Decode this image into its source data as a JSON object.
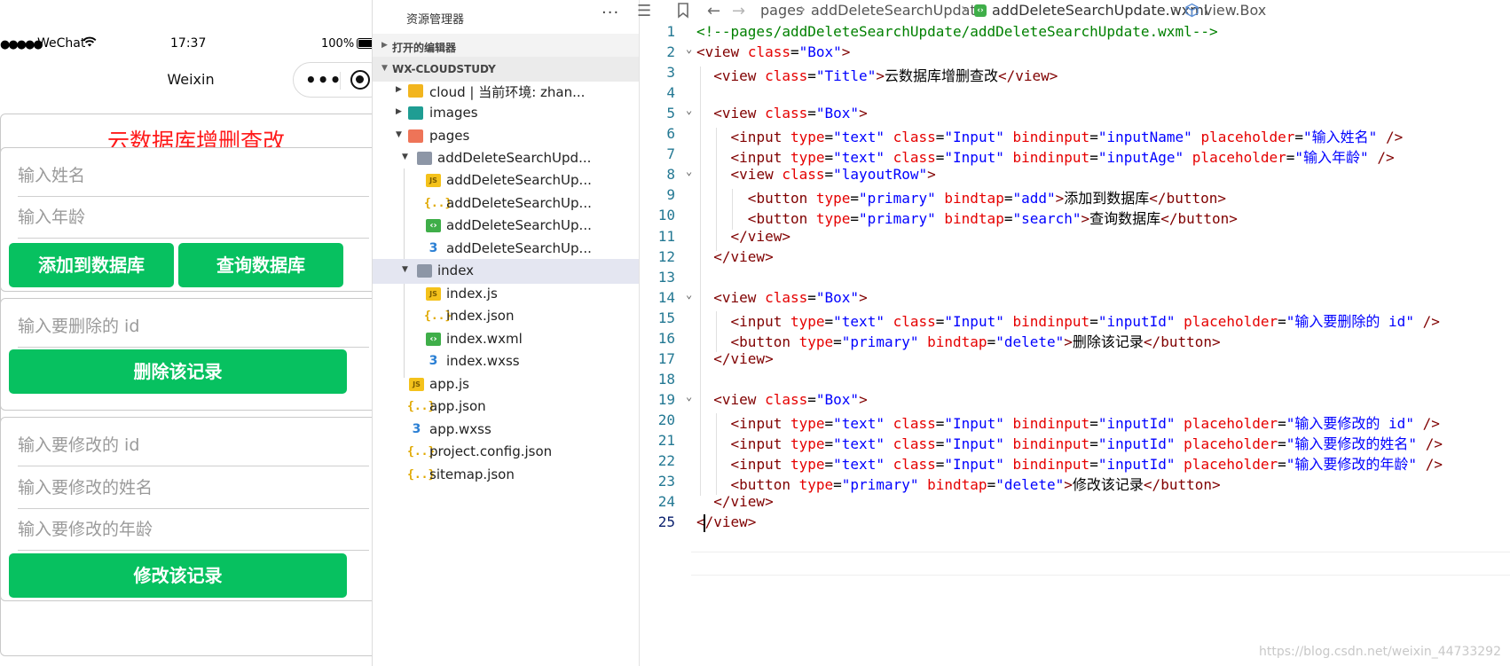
{
  "simulator": {
    "status": {
      "carrier": "WeChat",
      "time": "17:37",
      "battery": "100%"
    },
    "nav_title": "Weixin",
    "page_title": "云数据库增删查改",
    "box1": {
      "name_placeholder": "输入姓名",
      "age_placeholder": "输入年龄",
      "add_button": "添加到数据库",
      "search_button": "查询数据库"
    },
    "box2": {
      "id_placeholder": "输入要删除的 id",
      "delete_button": "删除该记录"
    },
    "box3": {
      "id_placeholder": "输入要修改的 id",
      "name_placeholder": "输入要修改的姓名",
      "age_placeholder": "输入要修改的年龄",
      "update_button": "修改该记录"
    }
  },
  "explorer": {
    "title": "资源管理器",
    "more": "···",
    "sections": {
      "open_editors": "打开的编辑器",
      "project": "WX-CLOUDSTUDY"
    },
    "tree": [
      {
        "label": "cloud | 当前环境: zhan...",
        "icon": "folder-cloud-icon"
      },
      {
        "label": "images",
        "icon": "folder-images-icon"
      },
      {
        "label": "pages",
        "icon": "folder-pages-icon"
      },
      {
        "label": "addDeleteSearchUpd...",
        "icon": "folder-open-icon"
      },
      {
        "label": "addDeleteSearchUp...",
        "icon": "js-file-icon"
      },
      {
        "label": "addDeleteSearchUp...",
        "icon": "json-file-icon"
      },
      {
        "label": "addDeleteSearchUp...",
        "icon": "wxml-file-icon"
      },
      {
        "label": "addDeleteSearchUp...",
        "icon": "wxss-file-icon"
      },
      {
        "label": "index",
        "icon": "folder-open-icon"
      },
      {
        "label": "index.js",
        "icon": "js-file-icon"
      },
      {
        "label": "index.json",
        "icon": "json-file-icon"
      },
      {
        "label": "index.wxml",
        "icon": "wxml-file-icon"
      },
      {
        "label": "index.wxss",
        "icon": "wxss-file-icon"
      },
      {
        "label": "app.js",
        "icon": "js-file-icon"
      },
      {
        "label": "app.json",
        "icon": "json-file-icon"
      },
      {
        "label": "app.wxss",
        "icon": "wxss-file-icon"
      },
      {
        "label": "project.config.json",
        "icon": "json-file-icon"
      },
      {
        "label": "sitemap.json",
        "icon": "json-file-icon"
      }
    ]
  },
  "editor": {
    "breadcrumb": {
      "part1": "pages",
      "part2": "addDeleteSearchUpdate",
      "part3": "addDeleteSearchUpdate.wxml",
      "part4": "view.Box"
    },
    "lines": [
      [
        [
          "cmt",
          "<!--pages/addDeleteSearchUpdate/addDeleteSearchUpdate.wxml-->"
        ]
      ],
      [
        [
          "punct",
          "<"
        ],
        [
          "tag",
          "view"
        ],
        [
          "txt-c",
          " "
        ],
        [
          "attr",
          "class"
        ],
        [
          "txt-c",
          "="
        ],
        [
          "str",
          "\"Box\""
        ],
        [
          "punct",
          ">"
        ]
      ],
      [
        [
          "txt-c",
          "  "
        ],
        [
          "punct",
          "<"
        ],
        [
          "tag",
          "view"
        ],
        [
          "txt-c",
          " "
        ],
        [
          "attr",
          "class"
        ],
        [
          "txt-c",
          "="
        ],
        [
          "str",
          "\"Title\""
        ],
        [
          "punct",
          ">"
        ],
        [
          "txt-c",
          "云数据库增删查改"
        ],
        [
          "punct",
          "</"
        ],
        [
          "tag",
          "view"
        ],
        [
          "punct",
          ">"
        ]
      ],
      [],
      [
        [
          "txt-c",
          "  "
        ],
        [
          "punct",
          "<"
        ],
        [
          "tag",
          "view"
        ],
        [
          "txt-c",
          " "
        ],
        [
          "attr",
          "class"
        ],
        [
          "txt-c",
          "="
        ],
        [
          "str",
          "\"Box\""
        ],
        [
          "punct",
          ">"
        ]
      ],
      [
        [
          "txt-c",
          "    "
        ],
        [
          "punct",
          "<"
        ],
        [
          "tag",
          "input"
        ],
        [
          "txt-c",
          " "
        ],
        [
          "attr",
          "type"
        ],
        [
          "txt-c",
          "="
        ],
        [
          "str",
          "\"text\""
        ],
        [
          "txt-c",
          " "
        ],
        [
          "attr",
          "class"
        ],
        [
          "txt-c",
          "="
        ],
        [
          "str",
          "\"Input\""
        ],
        [
          "txt-c",
          " "
        ],
        [
          "attr",
          "bindinput"
        ],
        [
          "txt-c",
          "="
        ],
        [
          "str",
          "\"inputName\""
        ],
        [
          "txt-c",
          " "
        ],
        [
          "attr",
          "placeholder"
        ],
        [
          "txt-c",
          "="
        ],
        [
          "str",
          "\"输入姓名\""
        ],
        [
          "txt-c",
          " "
        ],
        [
          "punct",
          "/>"
        ]
      ],
      [
        [
          "txt-c",
          "    "
        ],
        [
          "punct",
          "<"
        ],
        [
          "tag",
          "input"
        ],
        [
          "txt-c",
          " "
        ],
        [
          "attr",
          "type"
        ],
        [
          "txt-c",
          "="
        ],
        [
          "str",
          "\"text\""
        ],
        [
          "txt-c",
          " "
        ],
        [
          "attr",
          "class"
        ],
        [
          "txt-c",
          "="
        ],
        [
          "str",
          "\"Input\""
        ],
        [
          "txt-c",
          " "
        ],
        [
          "attr",
          "bindinput"
        ],
        [
          "txt-c",
          "="
        ],
        [
          "str",
          "\"inputAge\""
        ],
        [
          "txt-c",
          " "
        ],
        [
          "attr",
          "placeholder"
        ],
        [
          "txt-c",
          "="
        ],
        [
          "str",
          "\"输入年龄\""
        ],
        [
          "txt-c",
          " "
        ],
        [
          "punct",
          "/>"
        ]
      ],
      [
        [
          "txt-c",
          "    "
        ],
        [
          "punct",
          "<"
        ],
        [
          "tag",
          "view"
        ],
        [
          "txt-c",
          " "
        ],
        [
          "attr",
          "class"
        ],
        [
          "txt-c",
          "="
        ],
        [
          "str",
          "\"layoutRow\""
        ],
        [
          "punct",
          ">"
        ]
      ],
      [
        [
          "txt-c",
          "      "
        ],
        [
          "punct",
          "<"
        ],
        [
          "tag",
          "button"
        ],
        [
          "txt-c",
          " "
        ],
        [
          "attr",
          "type"
        ],
        [
          "txt-c",
          "="
        ],
        [
          "str",
          "\"primary\""
        ],
        [
          "txt-c",
          " "
        ],
        [
          "attr",
          "bindtap"
        ],
        [
          "txt-c",
          "="
        ],
        [
          "str",
          "\"add\""
        ],
        [
          "punct",
          ">"
        ],
        [
          "txt-c",
          "添加到数据库"
        ],
        [
          "punct",
          "</"
        ],
        [
          "tag",
          "button"
        ],
        [
          "punct",
          ">"
        ]
      ],
      [
        [
          "txt-c",
          "      "
        ],
        [
          "punct",
          "<"
        ],
        [
          "tag",
          "button"
        ],
        [
          "txt-c",
          " "
        ],
        [
          "attr",
          "type"
        ],
        [
          "txt-c",
          "="
        ],
        [
          "str",
          "\"primary\""
        ],
        [
          "txt-c",
          " "
        ],
        [
          "attr",
          "bindtap"
        ],
        [
          "txt-c",
          "="
        ],
        [
          "str",
          "\"search\""
        ],
        [
          "punct",
          ">"
        ],
        [
          "txt-c",
          "查询数据库"
        ],
        [
          "punct",
          "</"
        ],
        [
          "tag",
          "button"
        ],
        [
          "punct",
          ">"
        ]
      ],
      [
        [
          "txt-c",
          "    "
        ],
        [
          "punct",
          "</"
        ],
        [
          "tag",
          "view"
        ],
        [
          "punct",
          ">"
        ]
      ],
      [
        [
          "txt-c",
          "  "
        ],
        [
          "punct",
          "</"
        ],
        [
          "tag",
          "view"
        ],
        [
          "punct",
          ">"
        ]
      ],
      [],
      [
        [
          "txt-c",
          "  "
        ],
        [
          "punct",
          "<"
        ],
        [
          "tag",
          "view"
        ],
        [
          "txt-c",
          " "
        ],
        [
          "attr",
          "class"
        ],
        [
          "txt-c",
          "="
        ],
        [
          "str",
          "\"Box\""
        ],
        [
          "punct",
          ">"
        ]
      ],
      [
        [
          "txt-c",
          "    "
        ],
        [
          "punct",
          "<"
        ],
        [
          "tag",
          "input"
        ],
        [
          "txt-c",
          " "
        ],
        [
          "attr",
          "type"
        ],
        [
          "txt-c",
          "="
        ],
        [
          "str",
          "\"text\""
        ],
        [
          "txt-c",
          " "
        ],
        [
          "attr",
          "class"
        ],
        [
          "txt-c",
          "="
        ],
        [
          "str",
          "\"Input\""
        ],
        [
          "txt-c",
          " "
        ],
        [
          "attr",
          "bindinput"
        ],
        [
          "txt-c",
          "="
        ],
        [
          "str",
          "\"inputId\""
        ],
        [
          "txt-c",
          " "
        ],
        [
          "attr",
          "placeholder"
        ],
        [
          "txt-c",
          "="
        ],
        [
          "str",
          "\"输入要删除的 id\""
        ],
        [
          "txt-c",
          " "
        ],
        [
          "punct",
          "/>"
        ]
      ],
      [
        [
          "txt-c",
          "    "
        ],
        [
          "punct",
          "<"
        ],
        [
          "tag",
          "button"
        ],
        [
          "txt-c",
          " "
        ],
        [
          "attr",
          "type"
        ],
        [
          "txt-c",
          "="
        ],
        [
          "str",
          "\"primary\""
        ],
        [
          "txt-c",
          " "
        ],
        [
          "attr",
          "bindtap"
        ],
        [
          "txt-c",
          "="
        ],
        [
          "str",
          "\"delete\""
        ],
        [
          "punct",
          ">"
        ],
        [
          "txt-c",
          "删除该记录"
        ],
        [
          "punct",
          "</"
        ],
        [
          "tag",
          "button"
        ],
        [
          "punct",
          ">"
        ]
      ],
      [
        [
          "txt-c",
          "  "
        ],
        [
          "punct",
          "</"
        ],
        [
          "tag",
          "view"
        ],
        [
          "punct",
          ">"
        ]
      ],
      [],
      [
        [
          "txt-c",
          "  "
        ],
        [
          "punct",
          "<"
        ],
        [
          "tag",
          "view"
        ],
        [
          "txt-c",
          " "
        ],
        [
          "attr",
          "class"
        ],
        [
          "txt-c",
          "="
        ],
        [
          "str",
          "\"Box\""
        ],
        [
          "punct",
          ">"
        ]
      ],
      [
        [
          "txt-c",
          "    "
        ],
        [
          "punct",
          "<"
        ],
        [
          "tag",
          "input"
        ],
        [
          "txt-c",
          " "
        ],
        [
          "attr",
          "type"
        ],
        [
          "txt-c",
          "="
        ],
        [
          "str",
          "\"text\""
        ],
        [
          "txt-c",
          " "
        ],
        [
          "attr",
          "class"
        ],
        [
          "txt-c",
          "="
        ],
        [
          "str",
          "\"Input\""
        ],
        [
          "txt-c",
          " "
        ],
        [
          "attr",
          "bindinput"
        ],
        [
          "txt-c",
          "="
        ],
        [
          "str",
          "\"inputId\""
        ],
        [
          "txt-c",
          " "
        ],
        [
          "attr",
          "placeholder"
        ],
        [
          "txt-c",
          "="
        ],
        [
          "str",
          "\"输入要修改的 id\""
        ],
        [
          "txt-c",
          " "
        ],
        [
          "punct",
          "/>"
        ]
      ],
      [
        [
          "txt-c",
          "    "
        ],
        [
          "punct",
          "<"
        ],
        [
          "tag",
          "input"
        ],
        [
          "txt-c",
          " "
        ],
        [
          "attr",
          "type"
        ],
        [
          "txt-c",
          "="
        ],
        [
          "str",
          "\"text\""
        ],
        [
          "txt-c",
          " "
        ],
        [
          "attr",
          "class"
        ],
        [
          "txt-c",
          "="
        ],
        [
          "str",
          "\"Input\""
        ],
        [
          "txt-c",
          " "
        ],
        [
          "attr",
          "bindinput"
        ],
        [
          "txt-c",
          "="
        ],
        [
          "str",
          "\"inputId\""
        ],
        [
          "txt-c",
          " "
        ],
        [
          "attr",
          "placeholder"
        ],
        [
          "txt-c",
          "="
        ],
        [
          "str",
          "\"输入要修改的姓名\""
        ],
        [
          "txt-c",
          " "
        ],
        [
          "punct",
          "/>"
        ]
      ],
      [
        [
          "txt-c",
          "    "
        ],
        [
          "punct",
          "<"
        ],
        [
          "tag",
          "input"
        ],
        [
          "txt-c",
          " "
        ],
        [
          "attr",
          "type"
        ],
        [
          "txt-c",
          "="
        ],
        [
          "str",
          "\"text\""
        ],
        [
          "txt-c",
          " "
        ],
        [
          "attr",
          "class"
        ],
        [
          "txt-c",
          "="
        ],
        [
          "str",
          "\"Input\""
        ],
        [
          "txt-c",
          " "
        ],
        [
          "attr",
          "bindinput"
        ],
        [
          "txt-c",
          "="
        ],
        [
          "str",
          "\"inputId\""
        ],
        [
          "txt-c",
          " "
        ],
        [
          "attr",
          "placeholder"
        ],
        [
          "txt-c",
          "="
        ],
        [
          "str",
          "\"输入要修改的年龄\""
        ],
        [
          "txt-c",
          " "
        ],
        [
          "punct",
          "/>"
        ]
      ],
      [
        [
          "txt-c",
          "    "
        ],
        [
          "punct",
          "<"
        ],
        [
          "tag",
          "button"
        ],
        [
          "txt-c",
          " "
        ],
        [
          "attr",
          "type"
        ],
        [
          "txt-c",
          "="
        ],
        [
          "str",
          "\"primary\""
        ],
        [
          "txt-c",
          " "
        ],
        [
          "attr",
          "bindtap"
        ],
        [
          "txt-c",
          "="
        ],
        [
          "str",
          "\"delete\""
        ],
        [
          "punct",
          ">"
        ],
        [
          "txt-c",
          "修改该记录"
        ],
        [
          "punct",
          "</"
        ],
        [
          "tag",
          "button"
        ],
        [
          "punct",
          ">"
        ]
      ],
      [
        [
          "txt-c",
          "  "
        ],
        [
          "punct",
          "</"
        ],
        [
          "tag",
          "view"
        ],
        [
          "punct",
          ">"
        ]
      ],
      [
        [
          "punct",
          "</"
        ],
        [
          "tag",
          "view"
        ],
        [
          "punct",
          ">"
        ]
      ]
    ]
  },
  "watermark": "https://blog.csdn.net/weixin_44733292"
}
